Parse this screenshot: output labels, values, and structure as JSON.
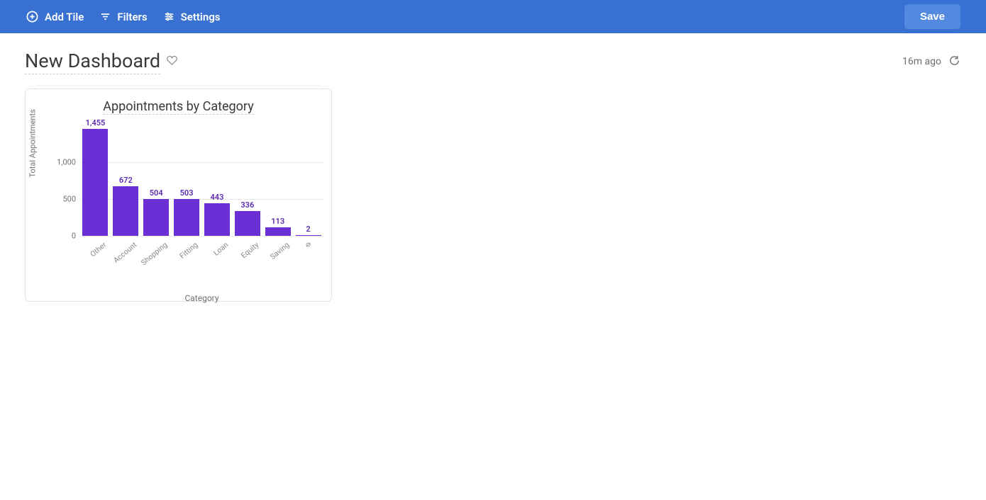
{
  "toolbar": {
    "add_tile_label": "Add Tile",
    "filters_label": "Filters",
    "settings_label": "Settings",
    "save_label": "Save"
  },
  "header": {
    "title": "New Dashboard",
    "last_refresh": "16m ago"
  },
  "tile": {
    "title": "Appointments by Category"
  },
  "chart_data": {
    "type": "bar",
    "title": "Appointments by Category",
    "xlabel": "Category",
    "ylabel": "Total Appointments",
    "categories": [
      "Other",
      "Account",
      "Shopping",
      "Fitting",
      "Loan",
      "Equity",
      "Saving",
      "∅"
    ],
    "values": [
      1455,
      672,
      504,
      503,
      443,
      336,
      113,
      2
    ],
    "value_labels": [
      "1,455",
      "672",
      "504",
      "503",
      "443",
      "336",
      "113",
      "2"
    ],
    "yticks": [
      0,
      500,
      1000
    ],
    "ytick_labels": [
      "0",
      "500",
      "1,000"
    ],
    "ylim": [
      0,
      1500
    ],
    "bar_color": "#6b2fd6"
  }
}
